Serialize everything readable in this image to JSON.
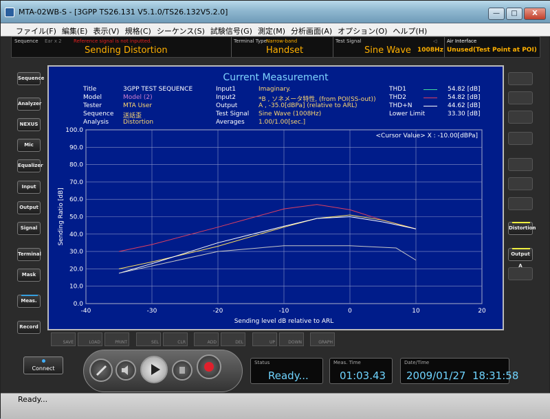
{
  "window": {
    "title": "MTA-02WB-S - [3GPP TS26.131 V5.1.0/TS26.132V5.2.0]",
    "min": "—",
    "max": "□",
    "close": "X"
  },
  "menu": [
    "ファイル(F)",
    "編集(E)",
    "表示(V)",
    "規格(C)",
    "シーケンス(S)",
    "試験信号(G)",
    "測定(M)",
    "分析画面(A)",
    "オプション(O)",
    "ヘルプ(H)"
  ],
  "status": {
    "sequence_label": "Sequence",
    "ear_label": "Ear x 2",
    "warning": "Reference signal is not inputted.",
    "sequence_value": "Sending Distortion",
    "terminal_label": "Terminal Type",
    "terminal_band": "Narrow-band",
    "terminal_value": "Handset",
    "signal_label": "Test Signal",
    "signal_value": "Sine Wave",
    "signal_freq": "1008Hz",
    "air_label": "Air Interface",
    "air_value": "Unused(Test Point at POI)"
  },
  "left_buttons": [
    "Sequence",
    "Analyzer",
    "NEXUS",
    "Mic",
    "Equalizer",
    "Input",
    "Output",
    "Signal",
    "Terminal",
    "Mask",
    "Meas.",
    "Record"
  ],
  "right_buttons": [
    "Distortion",
    "Output A"
  ],
  "panel": {
    "title": "Current Measurement",
    "info_labels": [
      "Title",
      "Model",
      "Tester",
      "Sequence",
      "Analysis"
    ],
    "info_values": [
      "3GPP TEST SEQUENCE",
      "Model (2)",
      "MTA User",
      "送話歪",
      "Distortion"
    ],
    "io_labels": [
      "Input1",
      "Input2",
      "Output",
      "Test Signal",
      "Averages"
    ],
    "io_values": [
      "Imaginary.",
      "*B , ソネメータ特性, (from POI(SS-out))",
      "A , -35.0[dBPa] (relative to ARL)",
      "Sine Wave (1008Hz)",
      "1.00/1.00[sec.]"
    ],
    "legend": [
      {
        "name": "THD1",
        "value": "54.82 [dB]",
        "color": "#40e0a0"
      },
      {
        "name": "THD2",
        "value": "54.82 [dB]",
        "color": "#e04060"
      },
      {
        "name": "THD+N",
        "value": "44.62 [dB]",
        "color": "#ffffff"
      },
      {
        "name": "Lower Limit",
        "value": "33.30 [dB]",
        "color": null
      }
    ],
    "cursor": "<Cursor Value> X : -10.00[dBPa]"
  },
  "chart_data": {
    "type": "line",
    "xlabel": "Sending level dB relative to ARL",
    "ylabel": "Sending Ratio [dB]",
    "xlim": [
      -40,
      20
    ],
    "ylim": [
      0,
      100
    ],
    "x_ticks": [
      "-40",
      "-30",
      "-20",
      "-10",
      "0",
      "10",
      "20"
    ],
    "y_ticks": [
      "0.0",
      "10.0",
      "20.0",
      "30.0",
      "40.0",
      "50.0",
      "60.0",
      "70.0",
      "80.0",
      "90.0",
      "100.0"
    ],
    "grid": true,
    "series": [
      {
        "name": "THD2",
        "color": "#e04060",
        "x": [
          -35,
          -30,
          -20,
          -10,
          -5,
          0,
          5,
          10
        ],
        "y": [
          30,
          34,
          44,
          54.5,
          57,
          54,
          48,
          43
        ]
      },
      {
        "name": "THD1",
        "color": "#ffe060",
        "x": [
          -35,
          -30,
          -20,
          -10,
          -5,
          0,
          5,
          10
        ],
        "y": [
          20,
          24,
          33,
          44,
          49,
          51,
          48,
          43
        ]
      },
      {
        "name": "THD+N",
        "color": "#ffffff",
        "x": [
          -35,
          -30,
          -20,
          -10,
          -5,
          0,
          5,
          10
        ],
        "y": [
          17.5,
          23,
          35,
          44.5,
          49,
          50,
          47,
          43
        ]
      },
      {
        "name": "Lower Limit",
        "color": "#c8c8c8",
        "x": [
          -35,
          -20,
          -10,
          0,
          7,
          10
        ],
        "y": [
          17.5,
          30,
          33.3,
          33.3,
          32,
          25
        ]
      }
    ]
  },
  "bottom_buttons": [
    "SAVE",
    "LOAD",
    "PRINT",
    "SEL",
    "CLR",
    "ADD",
    "DEL",
    "UP",
    "DOWN",
    "GRAPH"
  ],
  "connect_label": "Connect",
  "lcd": {
    "status_label": "Status",
    "status_value": "Ready...",
    "time_label": "Meas. Time",
    "time_value": "01:03.43",
    "date_label": "Date/Time",
    "date_value": "2009/01/27  18:31:58"
  },
  "statusbar": "Ready..."
}
